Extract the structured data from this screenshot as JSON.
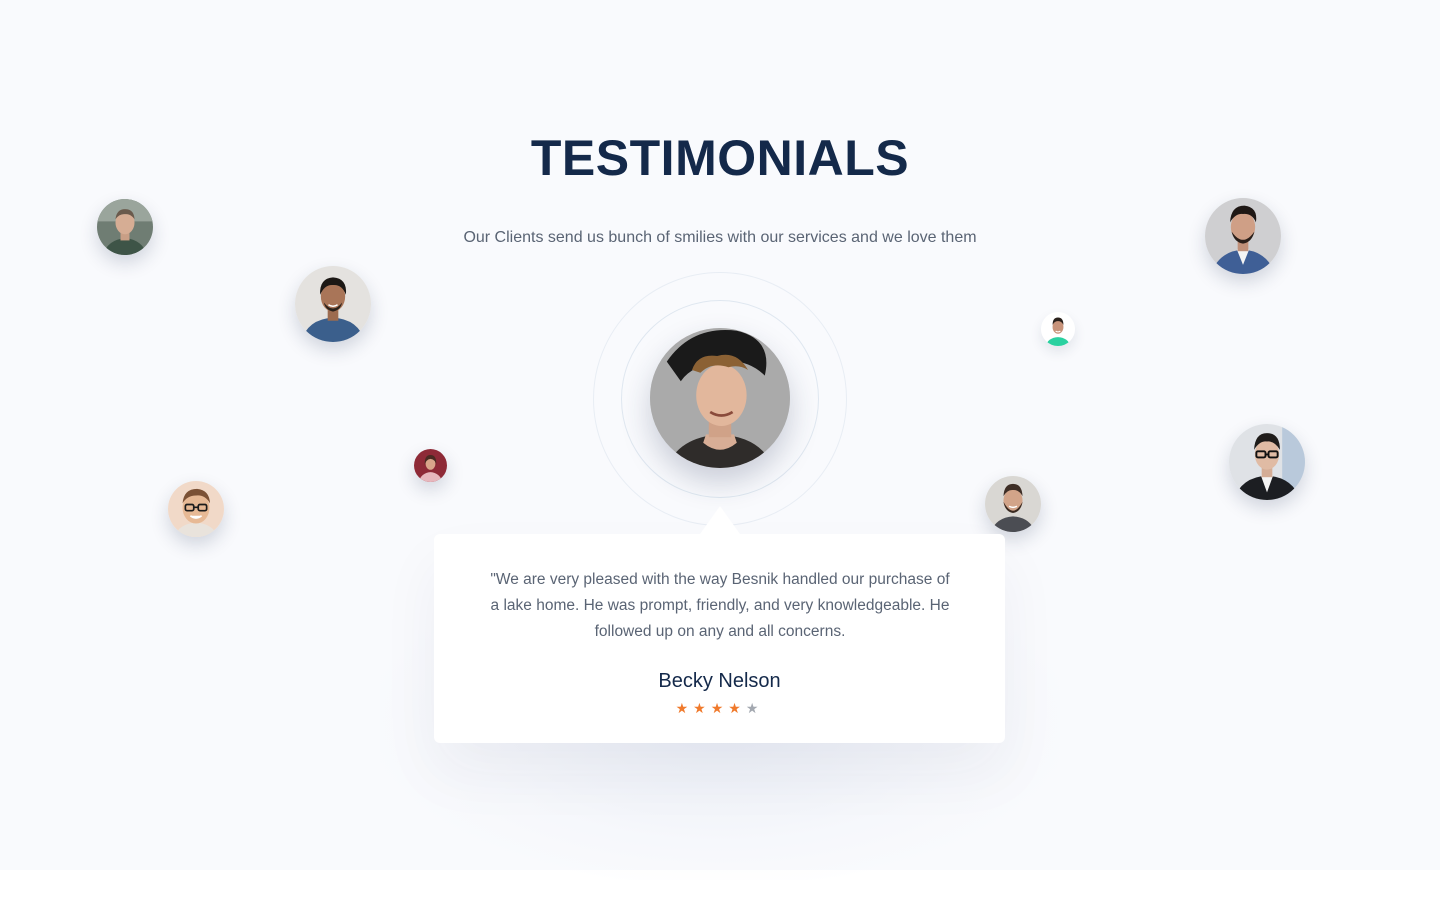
{
  "section": {
    "title": "TESTIMONIALS",
    "subtitle": "Our Clients send us bunch of smilies with our services and we love them"
  },
  "testimonial": {
    "quote": "\"We are very pleased with the way Besnik handled our purchase of a lake home. He was prompt, friendly, and very knowledgeable. He followed up on any and all concerns.",
    "author": "Becky Nelson",
    "rating": 4,
    "rating_max": 5,
    "star_on_color": "#f07a2c",
    "star_off_color": "#a3a8b0"
  },
  "avatars": [
    {
      "name": "client-avatar-1",
      "icon": "person-photo"
    },
    {
      "name": "client-avatar-2",
      "icon": "person-photo"
    },
    {
      "name": "client-avatar-3",
      "icon": "person-photo"
    },
    {
      "name": "client-avatar-4",
      "icon": "person-photo"
    },
    {
      "name": "client-avatar-5",
      "icon": "person-photo"
    },
    {
      "name": "client-avatar-6",
      "icon": "person-photo"
    },
    {
      "name": "client-avatar-7",
      "icon": "person-photo"
    },
    {
      "name": "client-avatar-8",
      "icon": "person-photo"
    },
    {
      "name": "client-avatar-9",
      "icon": "person-photo"
    }
  ],
  "colors": {
    "heading": "#14294a",
    "body_text": "#5a6474",
    "background": "#f9fafd"
  }
}
